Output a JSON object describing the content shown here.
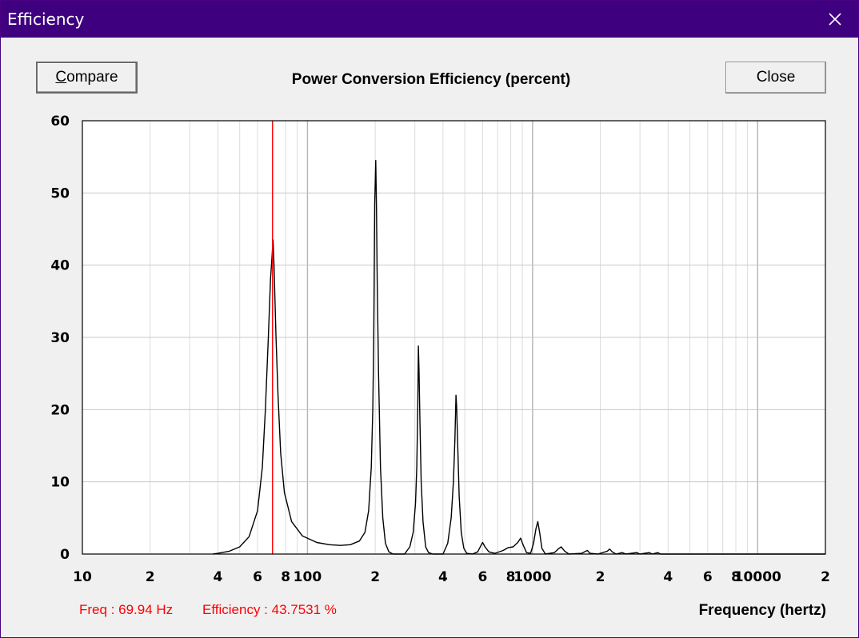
{
  "window": {
    "title": "Efficiency",
    "close_glyph": "✕"
  },
  "toolbar": {
    "compare_label": "Compare",
    "close_label": "Close"
  },
  "readout": {
    "freq": "Freq : 69.94 Hz",
    "efficiency": "Efficiency : 43.7531 %"
  },
  "colors": {
    "titlebar": "#3f0080",
    "cursor": "#ff0000",
    "curve": "#000000",
    "grid": "#c0c0c0"
  },
  "chart_data": {
    "type": "line",
    "title": "Power Conversion Efficiency (percent)",
    "xlabel": "Frequency (hertz)",
    "ylabel": "",
    "xscale": "log",
    "xlim": [
      10,
      20000
    ],
    "ylim": [
      0,
      60
    ],
    "grid": true,
    "yticks": [
      0,
      10,
      20,
      30,
      40,
      50,
      60
    ],
    "xtick_labels": [
      {
        "value": 10,
        "label": "10"
      },
      {
        "value": 20,
        "label": "2"
      },
      {
        "value": 40,
        "label": "4"
      },
      {
        "value": 60,
        "label": "6"
      },
      {
        "value": 80,
        "label": "8"
      },
      {
        "value": 100,
        "label": "100"
      },
      {
        "value": 200,
        "label": "2"
      },
      {
        "value": 400,
        "label": "4"
      },
      {
        "value": 600,
        "label": "6"
      },
      {
        "value": 800,
        "label": "8"
      },
      {
        "value": 1000,
        "label": "1000"
      },
      {
        "value": 2000,
        "label": "2"
      },
      {
        "value": 4000,
        "label": "4"
      },
      {
        "value": 6000,
        "label": "6"
      },
      {
        "value": 8000,
        "label": "8"
      },
      {
        "value": 10000,
        "label": "10000"
      },
      {
        "value": 20000,
        "label": "2"
      }
    ],
    "cursor_x": 69.94,
    "series": [
      {
        "points": [
          [
            38,
            0
          ],
          [
            40,
            0.1
          ],
          [
            45,
            0.4
          ],
          [
            50,
            1.0
          ],
          [
            55,
            2.4
          ],
          [
            60,
            6.0
          ],
          [
            63,
            12.0
          ],
          [
            65,
            20.0
          ],
          [
            67,
            30.0
          ],
          [
            68.5,
            38.0
          ],
          [
            69.5,
            41.0
          ],
          [
            70.3,
            43.5
          ],
          [
            71,
            40.0
          ],
          [
            72.5,
            30.0
          ],
          [
            74,
            22.0
          ],
          [
            76,
            14.0
          ],
          [
            79,
            8.5
          ],
          [
            85,
            4.5
          ],
          [
            95,
            2.5
          ],
          [
            110,
            1.6
          ],
          [
            125,
            1.3
          ],
          [
            140,
            1.2
          ],
          [
            155,
            1.3
          ],
          [
            170,
            1.8
          ],
          [
            180,
            3.0
          ],
          [
            187,
            6.0
          ],
          [
            192,
            12.0
          ],
          [
            195,
            20.0
          ],
          [
            197,
            30.0
          ],
          [
            199,
            48.5
          ],
          [
            201,
            54.5
          ],
          [
            202.5,
            48.0
          ],
          [
            204,
            38.0
          ],
          [
            207,
            25.0
          ],
          [
            211,
            12.0
          ],
          [
            216,
            5.0
          ],
          [
            222,
            1.5
          ],
          [
            230,
            0.3
          ],
          [
            240,
            0
          ],
          [
            270,
            0
          ],
          [
            285,
            1.0
          ],
          [
            295,
            3.0
          ],
          [
            302,
            7.0
          ],
          [
            306,
            12.0
          ],
          [
            309,
            20.0
          ],
          [
            311,
            28.8
          ],
          [
            313,
            25.5
          ],
          [
            316,
            18.0
          ],
          [
            320,
            10.0
          ],
          [
            326,
            4.5
          ],
          [
            335,
            1.0
          ],
          [
            345,
            0.2
          ],
          [
            360,
            0
          ],
          [
            400,
            0
          ],
          [
            420,
            1.5
          ],
          [
            435,
            5.0
          ],
          [
            445,
            10.0
          ],
          [
            452,
            16.0
          ],
          [
            457,
            22.0
          ],
          [
            460,
            20.5
          ],
          [
            465,
            15.0
          ],
          [
            472,
            8.0
          ],
          [
            482,
            3.0
          ],
          [
            495,
            0.8
          ],
          [
            510,
            0.1
          ],
          [
            540,
            0
          ],
          [
            570,
            0.3
          ],
          [
            590,
            1.2
          ],
          [
            600,
            1.6
          ],
          [
            615,
            1.0
          ],
          [
            640,
            0.3
          ],
          [
            680,
            0.1
          ],
          [
            740,
            0.5
          ],
          [
            780,
            0.9
          ],
          [
            820,
            1.0
          ],
          [
            860,
            1.6
          ],
          [
            885,
            2.2
          ],
          [
            910,
            1.2
          ],
          [
            940,
            0.2
          ],
          [
            980,
            0.1
          ],
          [
            1010,
            1.5
          ],
          [
            1035,
            3.5
          ],
          [
            1055,
            4.5
          ],
          [
            1075,
            3.0
          ],
          [
            1100,
            0.8
          ],
          [
            1140,
            0
          ],
          [
            1250,
            0.2
          ],
          [
            1300,
            0.7
          ],
          [
            1340,
            1.0
          ],
          [
            1390,
            0.4
          ],
          [
            1450,
            0
          ],
          [
            1650,
            0.1
          ],
          [
            1750,
            0.5
          ],
          [
            1800,
            0.1
          ],
          [
            1950,
            0
          ],
          [
            2150,
            0.4
          ],
          [
            2200,
            0.7
          ],
          [
            2260,
            0.3
          ],
          [
            2350,
            0
          ],
          [
            2500,
            0.2
          ],
          [
            2600,
            0
          ],
          [
            2900,
            0.2
          ],
          [
            3000,
            0
          ],
          [
            3300,
            0.2
          ],
          [
            3400,
            0
          ],
          [
            3600,
            0.2
          ],
          [
            3700,
            0
          ],
          [
            20000,
            0
          ]
        ]
      }
    ]
  }
}
